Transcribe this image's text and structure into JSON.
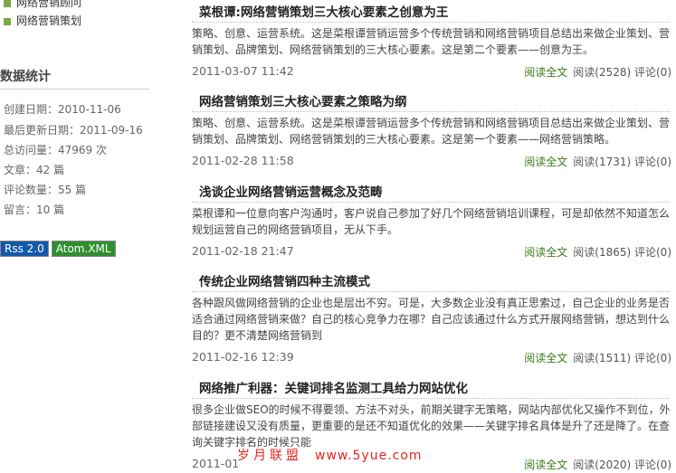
{
  "sidebar": {
    "categories": [
      "网络营销顾问",
      "网络营销策划"
    ],
    "stats_title": "数据统计",
    "stats": [
      "创建日期：2010-11-06",
      "最后更新日期：2011-09-16",
      "总访问量：47969 次",
      "文章：42 篇",
      "评论数量：55 篇",
      "留言：10 篇"
    ],
    "feeds": {
      "rss": "Rss 2.0",
      "atom": "Atom.XML"
    }
  },
  "posts": [
    {
      "title": "菜根谭:网络营销策划三大核心要素之创意为王",
      "body": "策略、创意、运营系统。这是菜根谭营销运营多个传统营销和网络营销项目总结出来做企业策划、营销策划、品牌策划、网络营销策划的三大核心要素。这是第二个要素——创意为王。",
      "date": "2011-03-07 11:42",
      "read_full": "阅读全文",
      "reads": "阅读(2528)",
      "comments": "评论(0)"
    },
    {
      "title": "网络营销策划三大核心要素之策略为纲",
      "body": "策略、创意、运营系统。这是菜根谭营销运营多个传统营销和网络营销项目总结出来做企业策划、营销策划、品牌策划、网络营销策划的三大核心要素。这是第一个要素——网络营销策略。",
      "date": "2011-02-28 11:58",
      "read_full": "阅读全文",
      "reads": "阅读(1731)",
      "comments": "评论(0)"
    },
    {
      "title": "浅谈企业网络营销运营概念及范畴",
      "body": "菜根谭和一位意向客户沟通时，客户说自己参加了好几个网络营销培训课程，可是却依然不知道怎么规划运营自己的网络营销项目，无从下手。",
      "date": "2011-02-18 21:47",
      "read_full": "阅读全文",
      "reads": "阅读(1865)",
      "comments": "评论(0)"
    },
    {
      "title": "传统企业网络营销四种主流模式",
      "body": "各种跟风做网络营销的企业也是层出不穷。可是，大多数企业没有真正思索过，自己企业的业务是否适合通过网络营销来做？自己的核心竞争力在哪？自己应该通过什么方式开展网络营销，想达到什么目的？更不清楚网络营销到",
      "date": "2011-02-16 12:39",
      "read_full": "阅读全文",
      "reads": "阅读(1511)",
      "comments": "评论(0)"
    },
    {
      "title": "网络推广利器：关键词排名监测工具给力网站优化",
      "body": "很多企业做SEO的时候不得要领、方法不对头，前期关键字无策略，网站内部优化又操作不到位，外部链接建设又没有质量，更重要的是还不知道优化的效果——关键字排名具体是升了还是降了。在查询关键字排名的时候只能",
      "date": "2011-01",
      "read_full": "阅读全文",
      "reads": "阅读(2020)",
      "comments": "评论(0)"
    }
  ],
  "watermark": {
    "cn": "岁月联盟",
    "url": "www.5yue.com"
  }
}
